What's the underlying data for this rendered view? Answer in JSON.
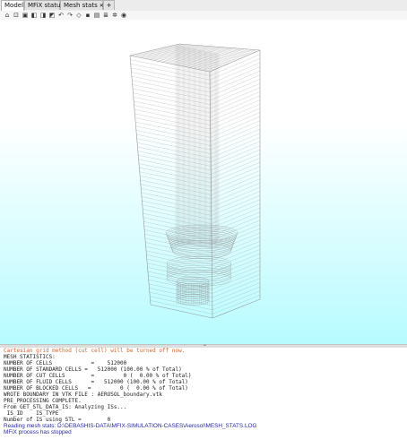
{
  "tabs": [
    {
      "label": "Model",
      "active": true
    },
    {
      "label": "MFiX status",
      "active": false
    },
    {
      "label": "Mesh stats",
      "active": false,
      "closable": true
    }
  ],
  "add_tab_label": "+",
  "close_glyph": "✕",
  "toolbar_icons": [
    "home-icon",
    "zoom-fit-icon",
    "cube-view-icon",
    "axis-x-icon",
    "axis-y-icon",
    "axis-z-icon",
    "rotate-left-icon",
    "rotate-right-icon",
    "perspective-icon",
    "screenshot-icon",
    "settings-icon",
    "layers-icon",
    "gear-icon",
    "visibility-icon"
  ],
  "viewport": {
    "background_top": "#ffffff",
    "background_bottom": "#b7fbff",
    "mesh_color": "#8e8e8e"
  },
  "console": {
    "lines": [
      {
        "text": "Cartesian grid method (cut cell) will be turned off now.",
        "style": "warning",
        "color": "#d5652a"
      },
      {
        "text": "MESH STATISTICS:",
        "style": "normal"
      },
      {
        "text": "NUMBER OF CELLS            =    512000",
        "style": "normal"
      },
      {
        "text": "NUMBER OF STANDARD CELLS =   512000 (100.00 % of Total)",
        "style": "normal"
      },
      {
        "text": "NUMBER OF CUT CELLS        =         0 (  0.00 % of Total)",
        "style": "normal"
      },
      {
        "text": "NUMBER OF FLUID CELLS      =   512000 (100.00 % of Total)",
        "style": "normal"
      },
      {
        "text": "NUMBER OF BLOCKED CELLS   =         0 (  0.00 % of Total)",
        "style": "normal"
      },
      {
        "text": "WROTE BOUNDARY IN VTK FILE : AEROSOL_boundary.vtk",
        "style": "normal"
      },
      {
        "text": "PRE_PROCESSING COMPLETE.",
        "style": "normal"
      },
      {
        "text": "From GET_STL_DATA_IS: Analyzing ISs...",
        "style": "normal"
      },
      {
        "text": " IS_ID    IS_TYPE",
        "style": "normal"
      },
      {
        "text": "Number of IS using STL =        0",
        "style": "normal"
      },
      {
        "text": "Reading mesh stats: D:\\DEBASHIS-DATA\\MFIX-SIMULATION-CASES\\Aerosol\\MESH_STATS.LOG",
        "style": "info",
        "color": "#2a2aa6"
      },
      {
        "text": "MFiX process has stopped",
        "style": "info",
        "color": "#2a2aa6"
      }
    ]
  }
}
